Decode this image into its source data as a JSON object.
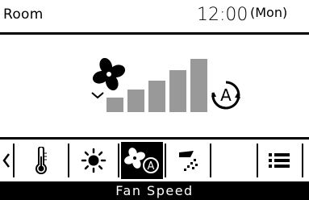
{
  "header": {
    "location": "Room",
    "time": "12:00",
    "day": "(Mon)"
  },
  "main": {
    "fan_icon": "fan-icon",
    "auto_icon": "auto-circle-icon",
    "auto_label": "A",
    "fan_speed_levels": 5,
    "selected_level": "auto"
  },
  "toolbar": {
    "items": [
      "chevron-left-icon",
      "thermometer-icon",
      "sun-icon",
      "fan-auto-icon",
      "louver-icon",
      "blank",
      "menu-icon"
    ],
    "selected_index": 3
  },
  "footer": {
    "label": "Fan Speed"
  },
  "colors": {
    "bar_gray": "#999999",
    "text": "#000000",
    "background": "#ffffff"
  }
}
